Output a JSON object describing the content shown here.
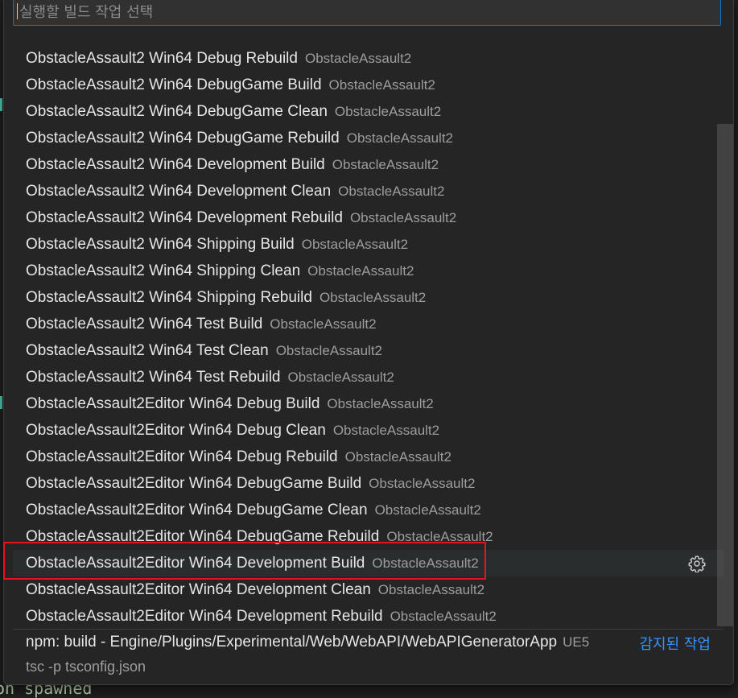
{
  "quick_pick": {
    "placeholder": "실행할 빌드 작업 선택",
    "value": ""
  },
  "tasks": [
    {
      "label": "ObstacleAssault2 Win64 Debug Rebuild",
      "description": "ObstacleAssault2"
    },
    {
      "label": "ObstacleAssault2 Win64 DebugGame Build",
      "description": "ObstacleAssault2"
    },
    {
      "label": "ObstacleAssault2 Win64 DebugGame Clean",
      "description": "ObstacleAssault2"
    },
    {
      "label": "ObstacleAssault2 Win64 DebugGame Rebuild",
      "description": "ObstacleAssault2"
    },
    {
      "label": "ObstacleAssault2 Win64 Development Build",
      "description": "ObstacleAssault2"
    },
    {
      "label": "ObstacleAssault2 Win64 Development Clean",
      "description": "ObstacleAssault2"
    },
    {
      "label": "ObstacleAssault2 Win64 Development Rebuild",
      "description": "ObstacleAssault2"
    },
    {
      "label": "ObstacleAssault2 Win64 Shipping Build",
      "description": "ObstacleAssault2"
    },
    {
      "label": "ObstacleAssault2 Win64 Shipping Clean",
      "description": "ObstacleAssault2"
    },
    {
      "label": "ObstacleAssault2 Win64 Shipping Rebuild",
      "description": "ObstacleAssault2"
    },
    {
      "label": "ObstacleAssault2 Win64 Test Build",
      "description": "ObstacleAssault2"
    },
    {
      "label": "ObstacleAssault2 Win64 Test Clean",
      "description": "ObstacleAssault2"
    },
    {
      "label": "ObstacleAssault2 Win64 Test Rebuild",
      "description": "ObstacleAssault2"
    },
    {
      "label": "ObstacleAssault2Editor Win64 Debug Build",
      "description": "ObstacleAssault2"
    },
    {
      "label": "ObstacleAssault2Editor Win64 Debug Clean",
      "description": "ObstacleAssault2"
    },
    {
      "label": "ObstacleAssault2Editor Win64 Debug Rebuild",
      "description": "ObstacleAssault2"
    },
    {
      "label": "ObstacleAssault2Editor Win64 DebugGame Build",
      "description": "ObstacleAssault2"
    },
    {
      "label": "ObstacleAssault2Editor Win64 DebugGame Clean",
      "description": "ObstacleAssault2"
    },
    {
      "label": "ObstacleAssault2Editor Win64 DebugGame Rebuild",
      "description": "ObstacleAssault2"
    },
    {
      "label": "ObstacleAssault2Editor Win64 Development Build",
      "description": "ObstacleAssault2",
      "selected": true,
      "icon": "gear-icon"
    },
    {
      "label": "ObstacleAssault2Editor Win64 Development Clean",
      "description": "ObstacleAssault2"
    },
    {
      "label": "ObstacleAssault2Editor Win64 Development Rebuild",
      "description": "ObstacleAssault2"
    }
  ],
  "detected_task": {
    "label": "npm: build - Engine/Plugins/Experimental/Web/WebAPI/WebAPIGeneratorApp",
    "description": "UE5",
    "detail": "tsc -p tsconfig.json",
    "group": "감지된 작업"
  },
  "background": {
    "terminal_text": "on spawned"
  },
  "colors": {
    "accent": "#0078d4",
    "highlight_box": "#e8141c",
    "group_label": "#3794ff"
  }
}
